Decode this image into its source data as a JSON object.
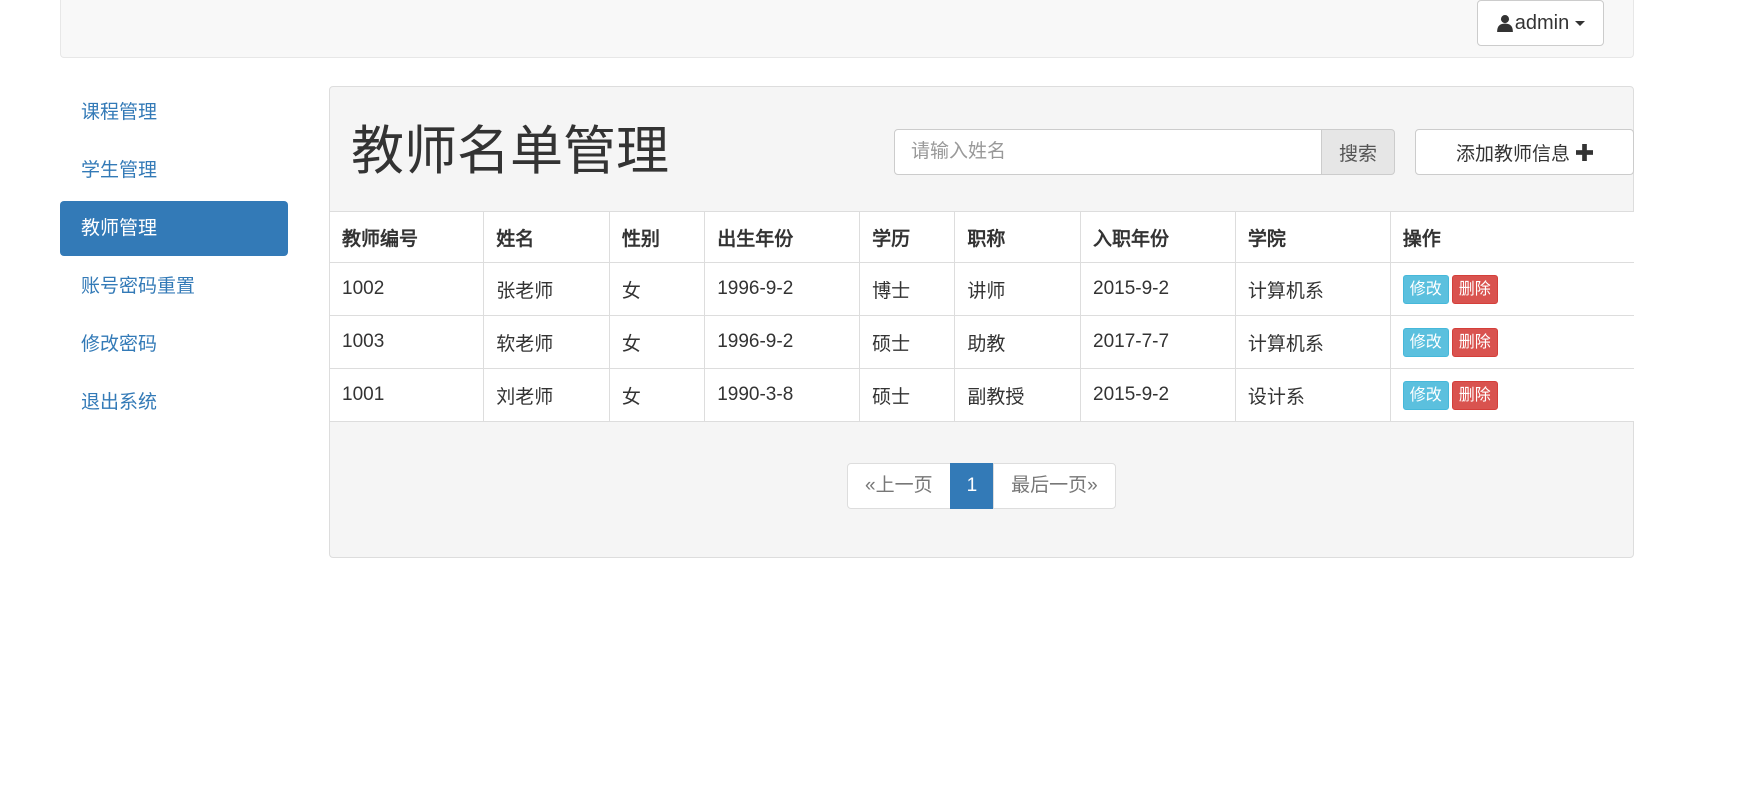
{
  "navbar": {
    "user_label": "admin"
  },
  "sidebar": {
    "items": [
      {
        "label": "课程管理",
        "active": false
      },
      {
        "label": "学生管理",
        "active": false
      },
      {
        "label": "教师管理",
        "active": true
      },
      {
        "label": "账号密码重置",
        "active": false
      },
      {
        "label": "修改密码",
        "active": false
      },
      {
        "label": "退出系统",
        "active": false
      }
    ]
  },
  "panel": {
    "title": "教师名单管理",
    "search": {
      "placeholder": "请输入姓名",
      "value": "",
      "button_label": "搜索"
    },
    "add_button_label": "添加教师信息"
  },
  "table": {
    "headers": [
      "教师编号",
      "姓名",
      "性别",
      "出生年份",
      "学历",
      "职称",
      "入职年份",
      "学院",
      "操作"
    ],
    "rows": [
      [
        "1002",
        "张老师",
        "女",
        "1996-9-2",
        "博士",
        "讲师",
        "2015-9-2",
        "计算机系"
      ],
      [
        "1003",
        "软老师",
        "女",
        "1996-9-2",
        "硕士",
        "助教",
        "2017-7-7",
        "计算机系"
      ],
      [
        "1001",
        "刘老师",
        "女",
        "1990-3-8",
        "硕士",
        "副教授",
        "2015-9-2",
        "设计系"
      ]
    ],
    "edit_label": "修改",
    "delete_label": "删除"
  },
  "pagination": {
    "prev_label": "«上一页",
    "current_page": "1",
    "last_label": "最后一页»"
  },
  "colors": {
    "primary": "#337ab7",
    "info": "#5bc0de",
    "danger": "#d9534f"
  }
}
